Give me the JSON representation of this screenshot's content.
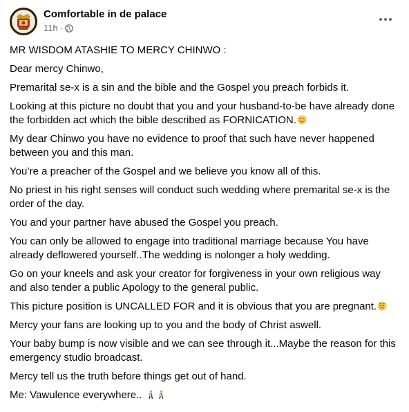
{
  "post": {
    "author": "Comfortable in de palace",
    "time": "11h",
    "separator": "·",
    "privacy_icon": "globe-icon",
    "more_icon": "more-horizontal-icon",
    "paragraphs": [
      "MR WISDOM ATASHIE TO MERCY CHINWO :",
      "Dear mercy Chinwo,",
      "Premarital se-x is a sin and the bible and the Gospel you preach forbids it.",
      "Looking at this picture no doubt that you and your husband-to-be have already done the forbidden act which the bible described as FORNICATION.",
      "My dear Chinwo you have no evidence to proof that such have never happened between you and this man.",
      "You’re a preacher of the Gospel and we believe you know all of this.",
      "No priest in his right senses will conduct such wedding where premarital se-x is the order of the day.",
      "You and your partner have abused the Gospel you preach.",
      "You can only be allowed to engage into traditional marriage because You have already deflowered yourself..The wedding is nolonger a holy wedding.",
      "Go on your kneels and ask your creator for forgiveness in your own religious way and also tender a public Apology to the general public.",
      "This picture position is UNCALLED FOR and it is obvious that you are pregnant.",
      "Mercy your fans are looking up to you and the body of Christ aswell.",
      "Your baby bump is now visible and we can see through it...Maybe the reason for this emergency studio broadcast.",
      "Mercy tell us the truth before things get out of hand.",
      "Me: Vawulence everywhere.."
    ],
    "emojis": {
      "p3": "relieved-face-emoji",
      "p10": "worried-face-emoji",
      "p14": "person-walking-emoji"
    }
  },
  "colors": {
    "text": "#050505",
    "secondary_text": "#65676b",
    "background": "#ffffff",
    "emoji_yellow": "#f7c84a"
  }
}
